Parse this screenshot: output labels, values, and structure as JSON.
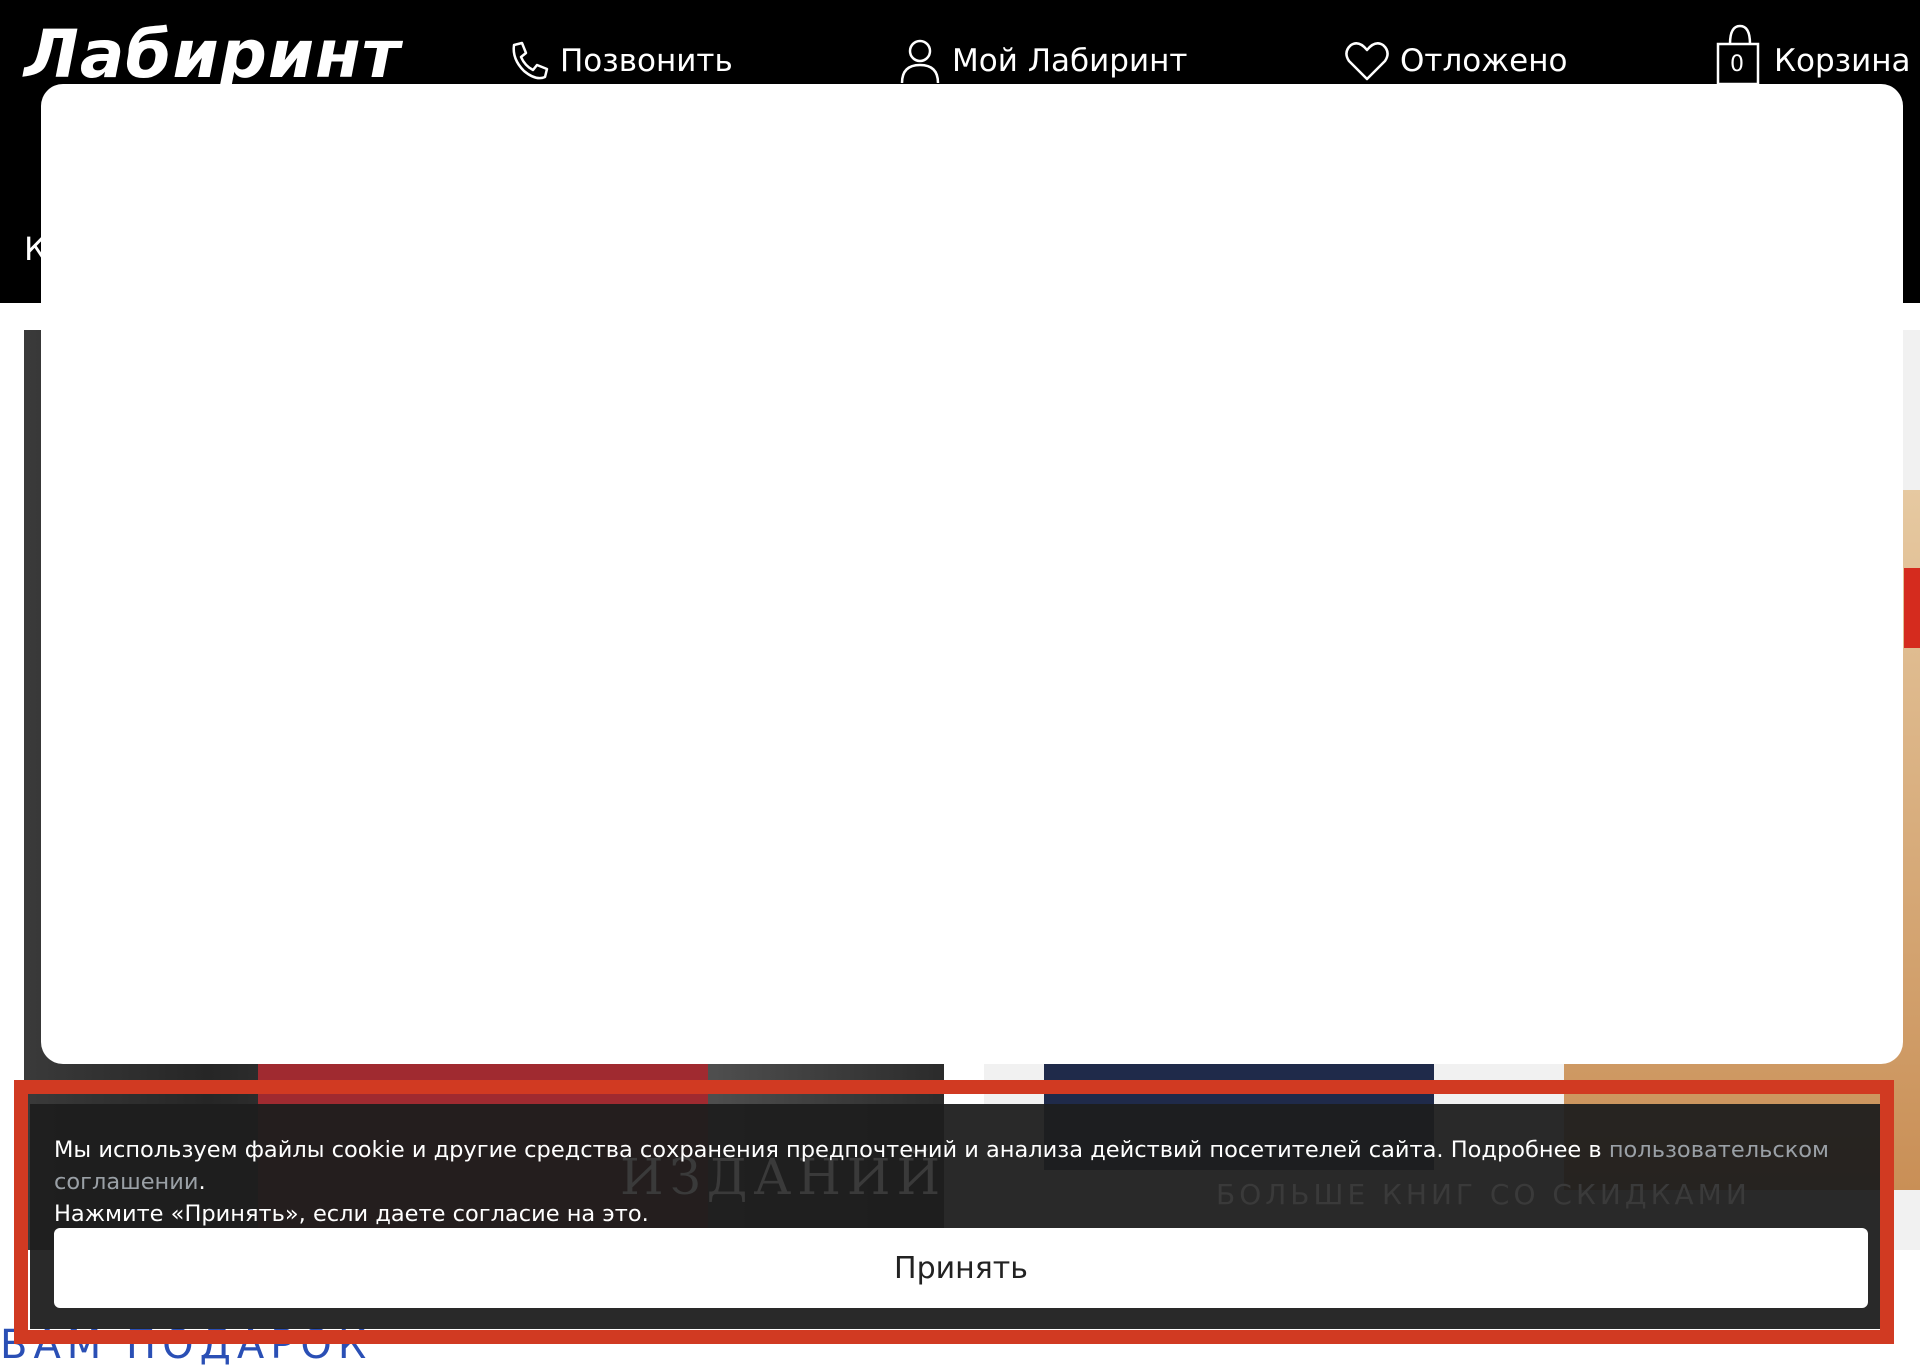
{
  "header": {
    "logo": "Лабиринт",
    "call_label": "Позвонить",
    "account_label": "Мой Лабиринт",
    "saved_label": "Отложено",
    "cart_label": "Корзина",
    "cart_count": "0",
    "menu_letter": "К"
  },
  "page": {
    "banner_left_caption": "ИЗДАНИЙ",
    "banner_right_caption": "БОЛЬШЕ КНИГ СО СКИДКАМИ",
    "gift_link": "ВАМ ПОДАРОК"
  },
  "cookie": {
    "text_before_link": "Мы используем файлы cookie и другие средства сохранения предпочтений и анализа действий посетителей сайта. Подробнее в ",
    "link_text": "пользовательском соглашении",
    "text_after_link": ".",
    "second_line": "Нажмите «Принять», если даете согласие на это.",
    "accept_label": "Принять"
  },
  "colors": {
    "header_bg": "#000000",
    "highlight_border": "#d13a22",
    "link_blue": "#2a4fb5",
    "sale_red": "#d52b1e"
  },
  "icons": [
    "phone-icon",
    "user-icon",
    "heart-icon",
    "shopping-bag-icon"
  ]
}
